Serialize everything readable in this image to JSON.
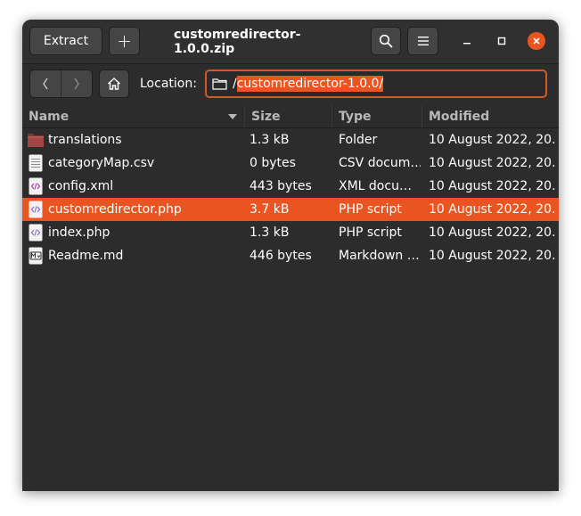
{
  "toolbar": {
    "extract_label": "Extract",
    "add_label": "+",
    "title": "customredirector-1.0.0.zip"
  },
  "location": {
    "label": "Location:",
    "slash": "/",
    "selected_path": "customredirector-1.0.0/"
  },
  "columns": {
    "name": "Name",
    "size": "Size",
    "type": "Type",
    "modified": "Modified"
  },
  "files": [
    {
      "icon": "folder-icon",
      "name": "translations",
      "size": "1.3 kB",
      "type": "Folder",
      "modified": "10 August 2022, 20…"
    },
    {
      "icon": "spreadsheet-file-icon",
      "name": "categoryMap.csv",
      "size": "0 bytes",
      "type": "CSV docum…",
      "modified": "10 August 2022, 20…"
    },
    {
      "icon": "xml-file-icon",
      "name": "config.xml",
      "size": "443 bytes",
      "type": "XML docu…",
      "modified": "10 August 2022, 20…"
    },
    {
      "icon": "php-file-icon",
      "name": "customredirector.php",
      "size": "3.7 kB",
      "type": "PHP script",
      "modified": "10 August 2022, 20…",
      "selected": true
    },
    {
      "icon": "php-file-icon",
      "name": "index.php",
      "size": "1.3 kB",
      "type": "PHP script",
      "modified": "10 August 2022, 20…"
    },
    {
      "icon": "markdown-file-icon",
      "name": "Readme.md",
      "size": "446 bytes",
      "type": "Markdown …",
      "modified": "10 August 2022, 20…"
    }
  ],
  "colors": {
    "accent": "#e95420",
    "window_bg": "#2c2c2c",
    "button_bg": "#454545"
  }
}
